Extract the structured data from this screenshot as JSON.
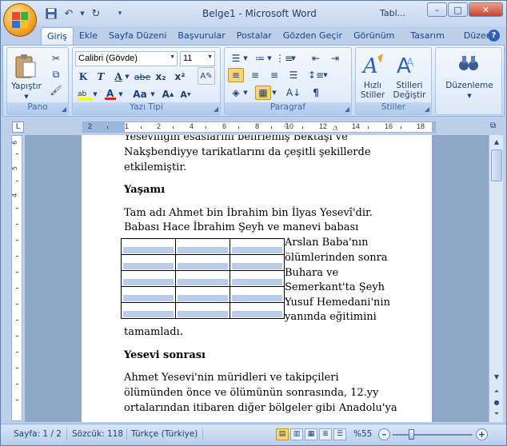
{
  "window": {
    "title": "Belge1 - Microsoft Word",
    "contextual_tab": "Tabl...",
    "minimize": "–",
    "maximize": "□",
    "close": "✕"
  },
  "ribbon": {
    "tabs": [
      "Giriş",
      "Ekle",
      "Sayfa Düzeni",
      "Başvurular",
      "Postalar",
      "Gözden Geçir",
      "Görünüm",
      "Tasarım",
      "Düzen"
    ],
    "active_tab": "Giriş",
    "groups": {
      "pano": {
        "label": "Pano",
        "paste_label": "Yapıştır"
      },
      "font": {
        "label": "Yazı Tipi",
        "font_name": "Calibri (Gövde)",
        "font_size": "11"
      },
      "paragraph": {
        "label": "Paragraf"
      },
      "styles": {
        "label": "Stiller",
        "quick_styles_label_1": "Hızlı",
        "quick_styles_label_2": "Stiller",
        "change_styles_label_1": "Stilleri",
        "change_styles_label_2": "Değiştir"
      },
      "editing": {
        "label": "Düzenleme"
      }
    }
  },
  "ruler": {
    "labels": [
      "2",
      "1",
      "2",
      "4",
      "6",
      "8",
      "10",
      "12",
      "14",
      "16",
      "18"
    ],
    "vertical_labels": [
      "6",
      "5",
      "4",
      "3",
      "2",
      "1",
      "1",
      "2",
      "3",
      "4",
      "5",
      "6",
      "7",
      "8",
      "9",
      "10"
    ]
  },
  "document": {
    "lines_top": [
      "Yesevîliğin esaslarını belirlemiş Bektaşî ve",
      "Nakşbendiyye tarikatlarını da çeşitli şekillerde",
      "etkilemiştir."
    ],
    "heading1": "Yaşamı",
    "para1_line1": "Tam adı Ahmet bin İbrahim bin İlyas Yesevî'dir.",
    "para1_line2": "Babası Hace İbrahim  Şeyh ve manevi babası",
    "wrap_lines": [
      "Arslan Baba'nın",
      "ölümlerinden sonra",
      "Buhara ve",
      "Semerkant'ta Şeyh",
      "Yusuf Hemedani'nin",
      "yanında eğitimini"
    ],
    "para1_end": "tamamladı.",
    "heading2": "Yesevi sonrası",
    "para2_lines": [
      "Ahmet Yesevi'nin müridleri ve takipçileri",
      "ölümünden önce ve ölümünün sonrasında, 12.yy",
      "ortalarından itibaren diğer bölgeler gibi Anadolu'ya"
    ],
    "table": {
      "rows": 5,
      "cols": 3
    }
  },
  "statusbar": {
    "page": "Sayfa: 1 / 2",
    "words": "Sözcük: 118",
    "language": "Türkçe (Türkiye)",
    "zoom": "%55",
    "zoom_out": "–",
    "zoom_in": "+"
  }
}
